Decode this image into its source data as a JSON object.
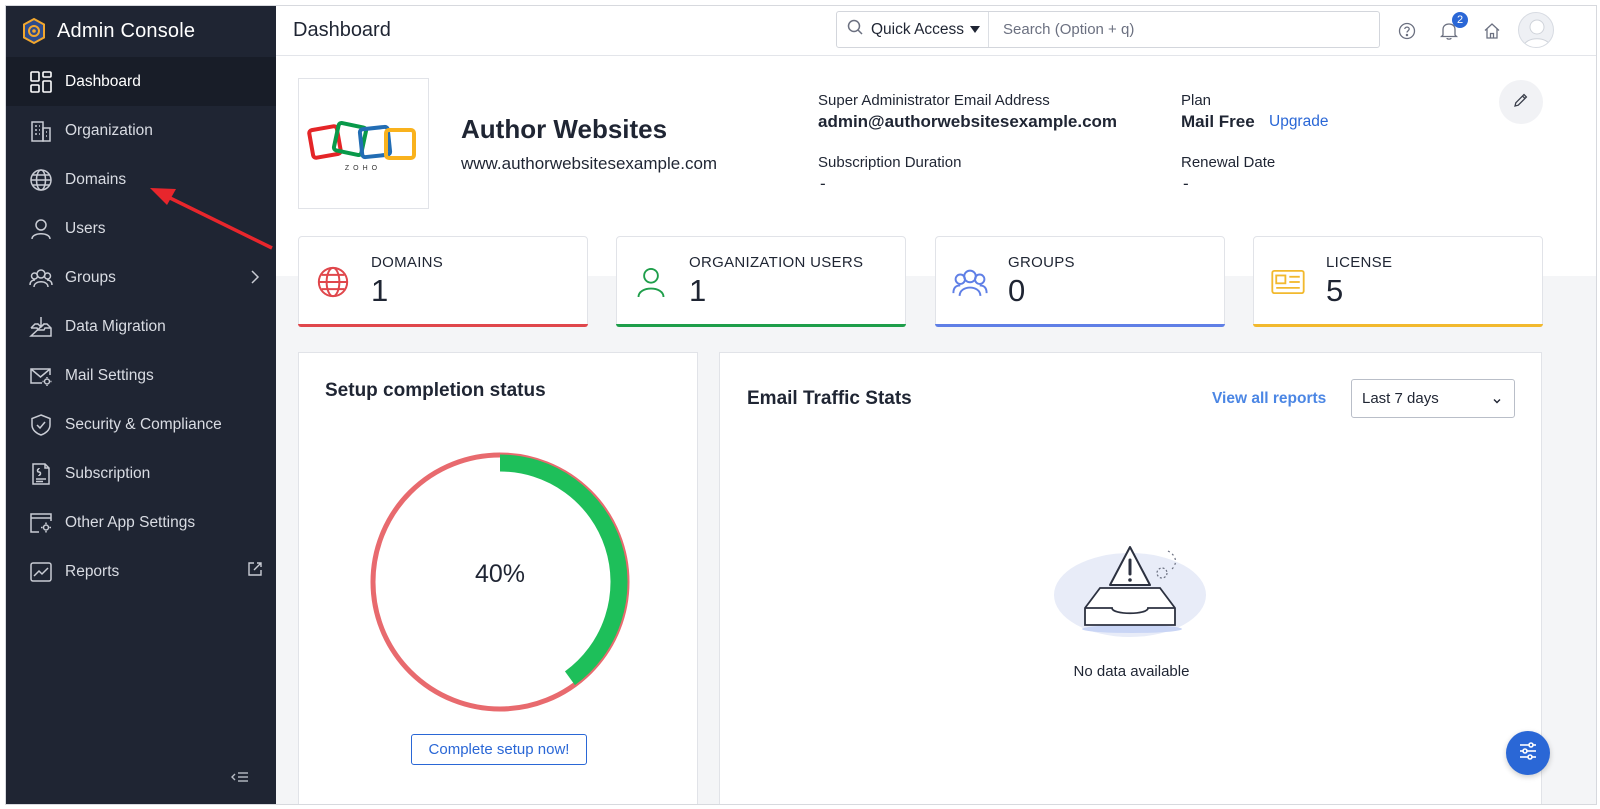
{
  "app": {
    "title": "Admin Console"
  },
  "sidebar": {
    "items": [
      {
        "label": "Dashboard",
        "icon": "dashboard-icon",
        "active": true
      },
      {
        "label": "Organization",
        "icon": "building-icon"
      },
      {
        "label": "Domains",
        "icon": "globe-icon"
      },
      {
        "label": "Users",
        "icon": "user-icon"
      },
      {
        "label": "Groups",
        "icon": "groups-icon",
        "has_submenu": true
      },
      {
        "label": "Data Migration",
        "icon": "data-migration-icon"
      },
      {
        "label": "Mail Settings",
        "icon": "mail-settings-icon"
      },
      {
        "label": "Security & Compliance",
        "icon": "shield-icon"
      },
      {
        "label": "Subscription",
        "icon": "subscription-icon"
      },
      {
        "label": "Other App Settings",
        "icon": "app-settings-icon"
      },
      {
        "label": "Reports",
        "icon": "reports-icon",
        "external": true
      }
    ]
  },
  "header": {
    "page_title": "Dashboard",
    "quick_access_label": "Quick Access",
    "search_placeholder": "Search (Option + q)",
    "notification_count": "2"
  },
  "org": {
    "name": "Author Websites",
    "url": "www.authorwebsitesexample.com",
    "logo_text": "ZOHO",
    "admin_email_label": "Super Administrator Email Address",
    "admin_email": "admin@authorwebsitesexample.com",
    "plan_label": "Plan",
    "plan_value": "Mail Free",
    "upgrade_label": "Upgrade",
    "subscription_duration_label": "Subscription Duration",
    "subscription_duration": "-",
    "renewal_label": "Renewal Date",
    "renewal_date": "-"
  },
  "stats": [
    {
      "label": "DOMAINS",
      "value": "1",
      "color": "#e0474c",
      "icon": "globe-icon"
    },
    {
      "label": "ORGANIZATION USERS",
      "value": "1",
      "color": "#1e9e4a",
      "icon": "user-icon"
    },
    {
      "label": "GROUPS",
      "value": "0",
      "color": "#5f7fe6",
      "icon": "groups-icon"
    },
    {
      "label": "LICENSE",
      "value": "5",
      "color": "#f2b92e",
      "icon": "license-icon"
    }
  ],
  "setup": {
    "title": "Setup completion status",
    "percent_label": "40%",
    "percent_value": 0.4,
    "button_label": "Complete setup now!",
    "track_color": "#e86a6e",
    "progress_color": "#1ebf5a"
  },
  "email_traffic": {
    "title": "Email Traffic Stats",
    "view_all_label": "View all reports",
    "range_selected": "Last 7 days",
    "empty_text": "No data available"
  },
  "colors": {
    "sidebar_bg": "#1f2533",
    "accent": "#2a67d6",
    "annotation_arrow": "#e8262c"
  }
}
